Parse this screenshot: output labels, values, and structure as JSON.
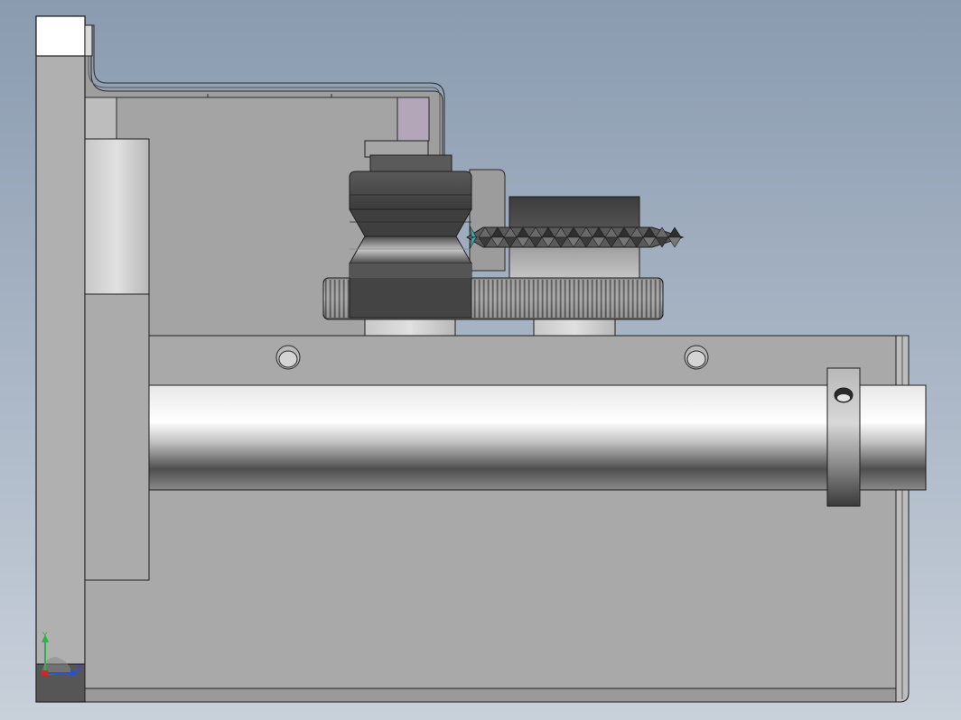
{
  "viewport": {
    "background_top": "#8a9bb0",
    "background_bottom": "#c8d0da"
  },
  "parts": [
    {
      "name": "base-plate",
      "color": "#a9a9a9"
    },
    {
      "name": "side-wall",
      "color": "#b2b2b2"
    },
    {
      "name": "bracket",
      "color": "#9c9c9c"
    },
    {
      "name": "guide-roller",
      "color": "#4a4a4a"
    },
    {
      "name": "spur-gear",
      "color": "#7a7a7a"
    },
    {
      "name": "serrated-feed-wheel",
      "color": "#3c3c3c"
    },
    {
      "name": "shaft",
      "color": "#d4d4d4"
    },
    {
      "name": "shaft-collar",
      "color": "#8d8d8d"
    }
  ],
  "triad": {
    "x_label": "",
    "y_label": "Y",
    "z_label": "Z",
    "y_color": "#2bb34a",
    "z_color": "#2a52c9",
    "origin_color": "#cc2a2a"
  }
}
